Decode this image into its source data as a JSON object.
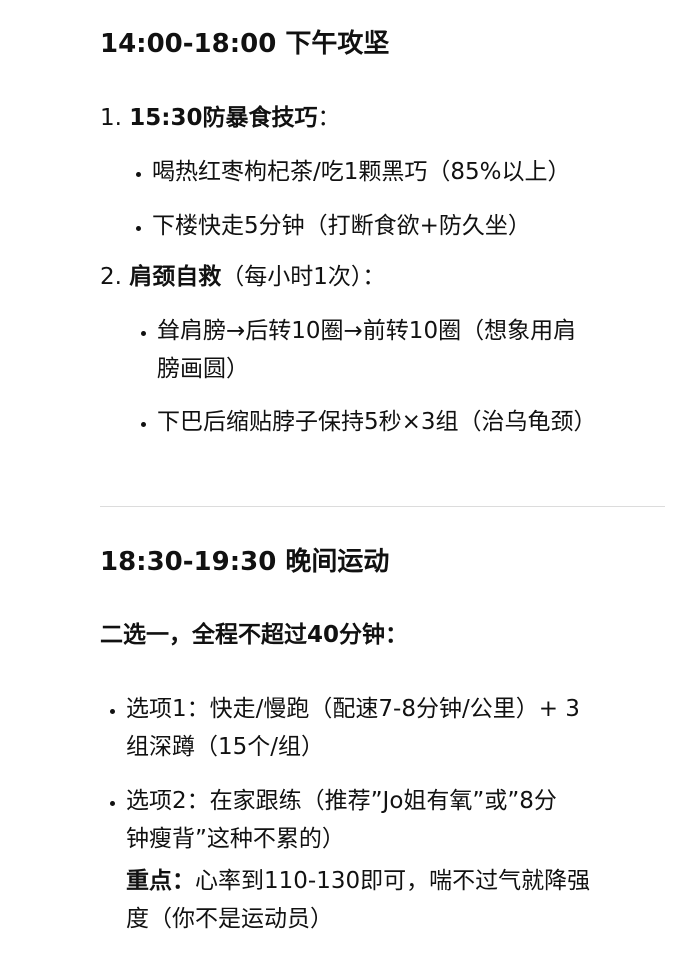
{
  "section1": {
    "heading": "14:00-18:00 下午攻坚",
    "item1": {
      "num": "1. ",
      "title": "15:30防暴食技巧",
      "suffix": "：",
      "bullets": [
        "喝热红枣枸杞茶/吃1颗黑巧（85%以上）",
        "下楼快走5分钟（打断食欲+防久坐）"
      ]
    },
    "item2": {
      "num": "2. ",
      "title": "肩颈自救",
      "suffix": "（每小时1次）：",
      "bullet1_line1": "耸肩膀→后转10圈→前转10圈（想象用肩",
      "bullet1_line2": "膀画圆）",
      "bullet2": "下巴后缩贴脖子保持5秒×3组（治乌龟颈）"
    }
  },
  "section2": {
    "heading": "18:30-19:30 晚间运动",
    "intro": "二选一，全程不超过40分钟：",
    "option1_line1": "选项1：快走/慢跑（配速7-8分钟/公里）+ 3",
    "option1_line2": "组深蹲（15个/组）",
    "option2_line1": "选项2：在家跟练（推荐”Jo姐有氧”或”8分",
    "option2_line2": "钟瘦背”这种不累的）",
    "focus_label": "重点：",
    "focus_text": "心率到110-130即可，喘不过气就降强",
    "focus_line2": "度（你不是运动员）"
  }
}
